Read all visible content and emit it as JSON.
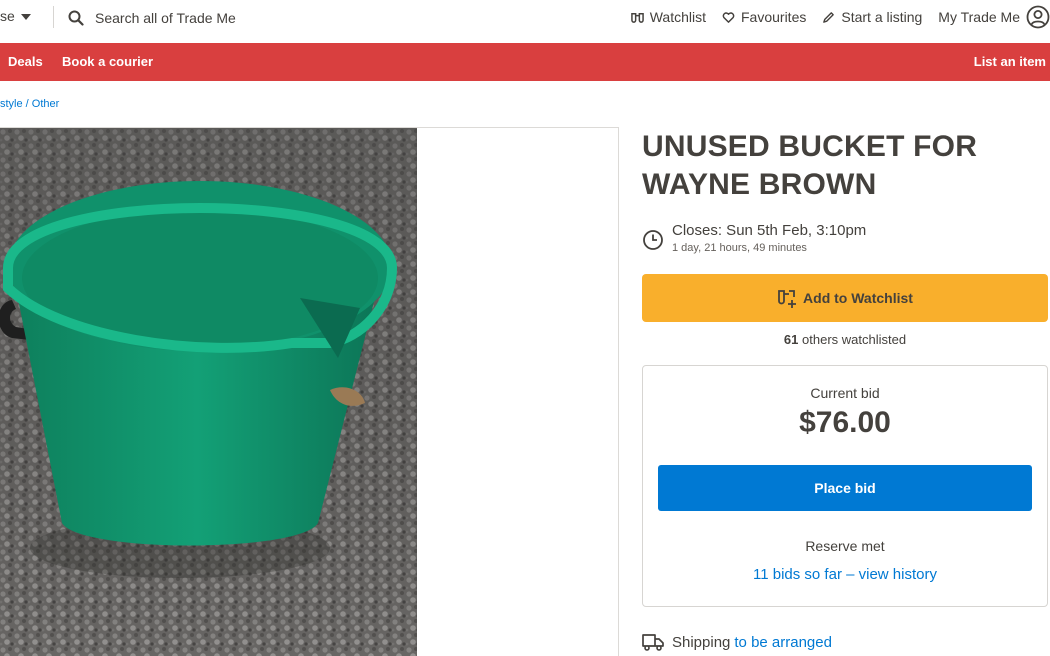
{
  "header": {
    "browse_label": "se",
    "search_placeholder": "Search all of Trade Me",
    "links": {
      "watchlist": "Watchlist",
      "favourites": "Favourites",
      "start_listing": "Start a listing",
      "my_trade_me": "My Trade Me"
    }
  },
  "nav": {
    "deals": "Deals",
    "book_courier": "Book a courier",
    "list_item": "List an item",
    "color": "#d93f3f"
  },
  "breadcrumb": "style / Other",
  "listing": {
    "title": "UNUSED BUCKET FOR WAYNE BROWN",
    "closes": "Closes: Sun 5th Feb, 3:10pm",
    "time_left": "1 day, 21 hours, 49 minutes",
    "watch_button": "Add to Watchlist",
    "watch_count": "61",
    "watch_count_suffix": "others watchlisted",
    "current_bid_label": "Current bid",
    "current_bid": "$76.00",
    "place_bid": "Place bid",
    "reserve": "Reserve met",
    "bid_history": "11 bids so far – view history",
    "shipping_label": "Shipping",
    "shipping_value": "to be arranged"
  },
  "icons": {
    "search": "search-icon",
    "watchlist": "binoculars-icon",
    "favourites": "heart-icon",
    "start_listing": "pencil-icon",
    "account": "user-circle-icon",
    "clock": "clock-icon",
    "watch_add": "binoculars-plus-icon",
    "shipping": "truck-icon"
  },
  "colors": {
    "watch_button": "#f9af2c",
    "primary_button": "#0079d3",
    "link": "#0079d3"
  }
}
